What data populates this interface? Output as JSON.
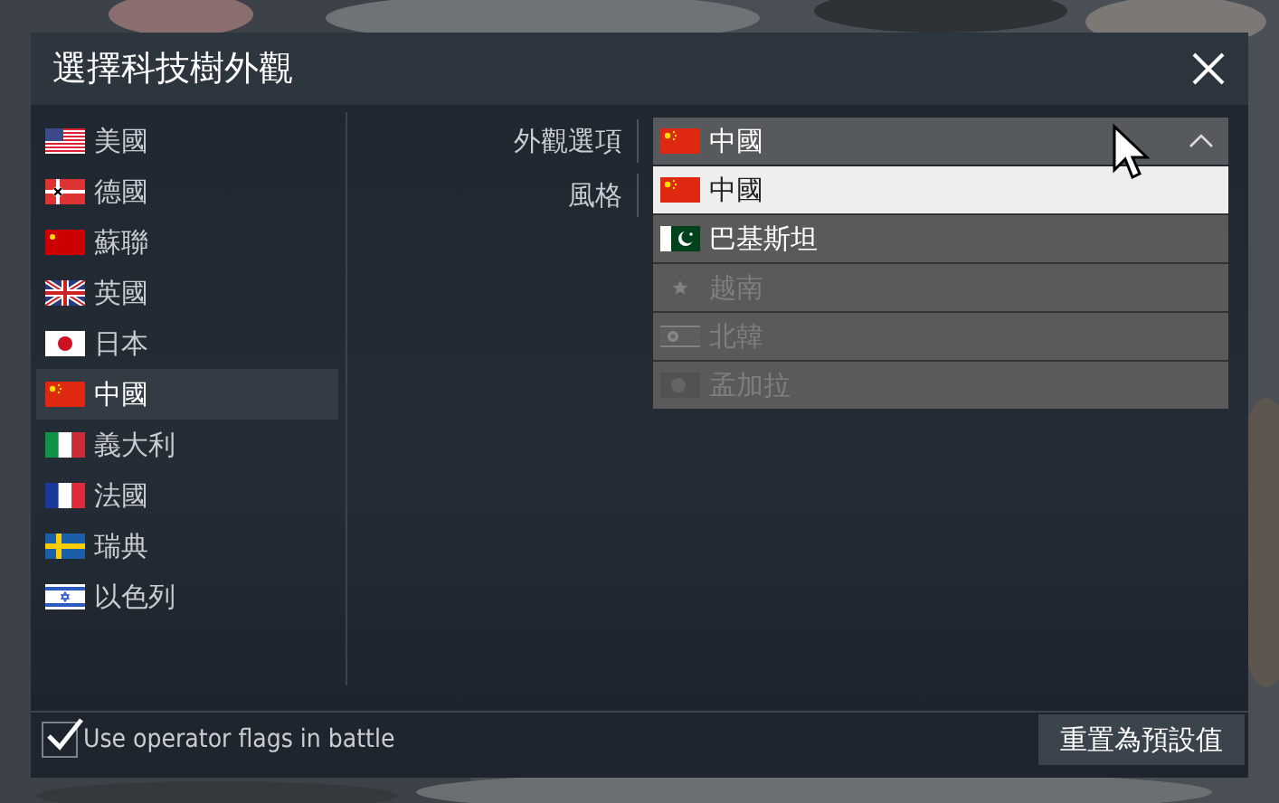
{
  "window": {
    "title": "選擇科技樹外觀"
  },
  "sidebar": {
    "items": [
      {
        "label": "美國",
        "kind": "usa",
        "selected": false
      },
      {
        "label": "德國",
        "kind": "germany",
        "selected": false
      },
      {
        "label": "蘇聯",
        "kind": "ussr",
        "selected": false
      },
      {
        "label": "英國",
        "kind": "uk",
        "selected": false
      },
      {
        "label": "日本",
        "kind": "japan",
        "selected": false
      },
      {
        "label": "中國",
        "kind": "china",
        "selected": true
      },
      {
        "label": "義大利",
        "kind": "italy",
        "selected": false
      },
      {
        "label": "法國",
        "kind": "france",
        "selected": false
      },
      {
        "label": "瑞典",
        "kind": "sweden",
        "selected": false
      },
      {
        "label": "以色列",
        "kind": "israel",
        "selected": false
      }
    ]
  },
  "settings": [
    {
      "label": "外觀選項"
    },
    {
      "label": "風格"
    }
  ],
  "dropdown": {
    "value": "中國",
    "kind": "china",
    "expanded": true,
    "options": [
      {
        "label": "中國",
        "kind": "china",
        "selected": true,
        "disabled": false
      },
      {
        "label": "巴基斯坦",
        "kind": "pakistan",
        "selected": false,
        "disabled": false
      },
      {
        "label": "越南",
        "kind": "vietnam",
        "selected": false,
        "disabled": true
      },
      {
        "label": "北韓",
        "kind": "north_korea",
        "selected": false,
        "disabled": true
      },
      {
        "label": "孟加拉",
        "kind": "bangladesh",
        "selected": false,
        "disabled": true
      }
    ]
  },
  "footer": {
    "checkbox": {
      "label": "Use operator flags in battle",
      "checked": true
    },
    "button": "重置為預設值"
  }
}
